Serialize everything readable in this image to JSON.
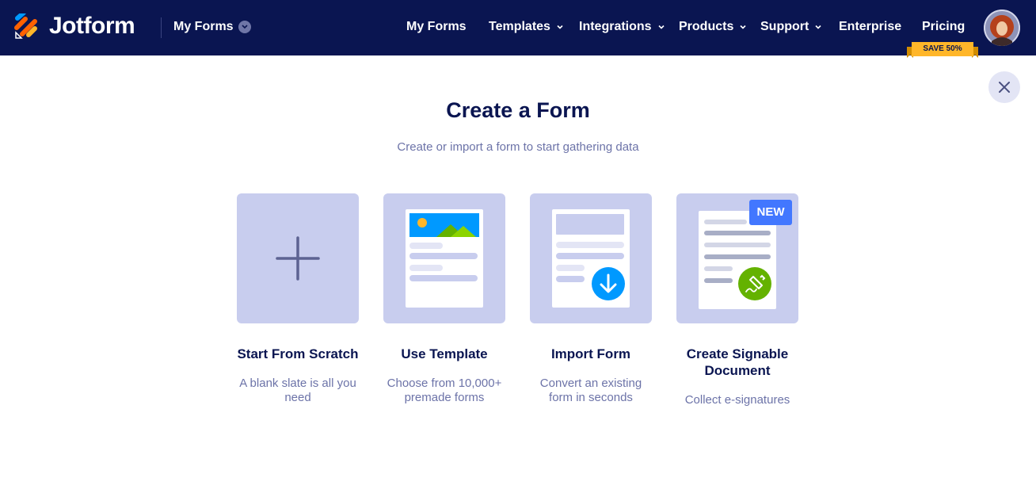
{
  "brand": {
    "name": "Jotform",
    "menu_label": "My Forms"
  },
  "nav": {
    "items": [
      {
        "label": "My Forms",
        "dropdown": false
      },
      {
        "label": "Templates",
        "dropdown": true
      },
      {
        "label": "Integrations",
        "dropdown": true
      },
      {
        "label": "Products",
        "dropdown": true
      },
      {
        "label": "Support",
        "dropdown": true
      },
      {
        "label": "Enterprise",
        "dropdown": false
      },
      {
        "label": "Pricing",
        "dropdown": false
      }
    ],
    "pricing_badge": "SAVE 50%"
  },
  "dialog": {
    "title": "Create a Form",
    "subtitle": "Create or import a form to start gathering data"
  },
  "options": [
    {
      "title": "Start From Scratch",
      "description": "A blank slate is all you need"
    },
    {
      "title": "Use Template",
      "description": "Choose from 10,000+ premade forms"
    },
    {
      "title": "Import Form",
      "description": "Convert an existing form in seconds"
    },
    {
      "title": "Create Signable Document",
      "description": "Collect e-signatures",
      "badge": "NEW"
    }
  ],
  "colors": {
    "header_bg": "#0a1551",
    "tile_bg": "#c8cdee",
    "accent_blue": "#4277ff",
    "import_blue": "#0099ff",
    "sign_green": "#64b200",
    "badge_orange": "#ffb629"
  },
  "icons": {
    "close": "close-icon",
    "plus": "plus-icon",
    "download": "download-arrow-icon",
    "pen": "pen-nib-icon",
    "chevron": "chevron-down-icon"
  }
}
